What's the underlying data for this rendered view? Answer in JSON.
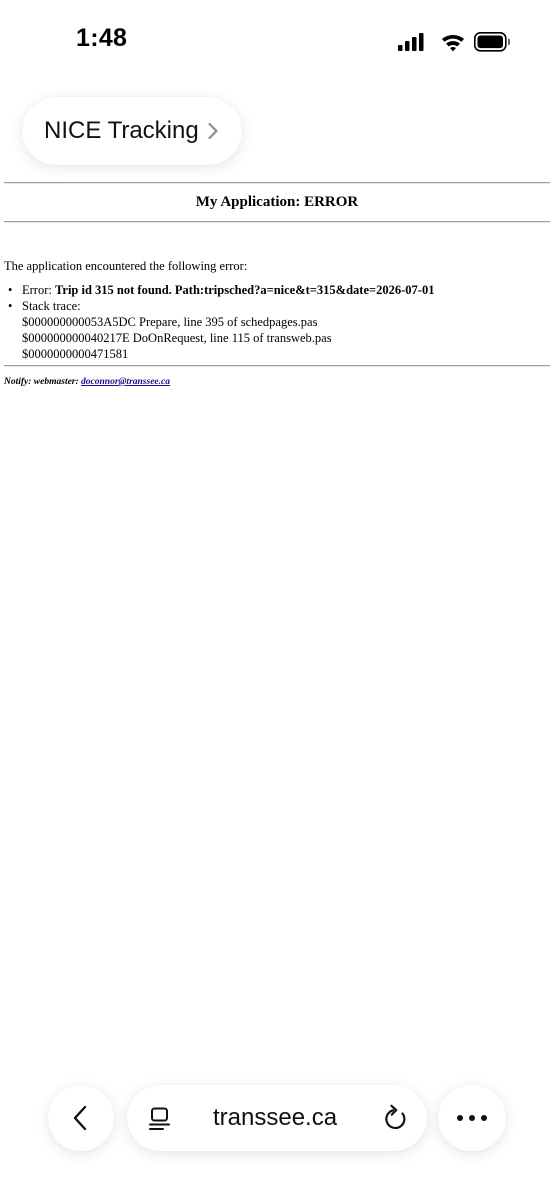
{
  "status_bar": {
    "time": "1:48"
  },
  "site_pill": {
    "label": "NICE Tracking"
  },
  "content": {
    "heading": "My Application: ERROR",
    "intro": "The application encountered the following error:",
    "error_prefix": "Error: ",
    "error_message": "Trip id 315 not found. Path:tripsched?a=nice&t=315&date=2026-07-01",
    "stack_label": "Stack trace:",
    "stack_trace": [
      "$000000000053A5DC Prepare, line 395 of schedpages.pas",
      "$000000000040217E DoOnRequest, line 115 of transweb.pas",
      "$0000000000471581"
    ],
    "notify_label": "Notify: webmaster: ",
    "notify_email": "doconnor@transsee.ca"
  },
  "toolbar": {
    "address": "transsee.ca"
  },
  "icons": {
    "status": [
      "cellular-signal-icon",
      "wifi-icon",
      "battery-icon"
    ],
    "toolbar": [
      "back-chevron-icon",
      "tab-overview-icon",
      "reload-icon",
      "more-dots-icon"
    ]
  }
}
